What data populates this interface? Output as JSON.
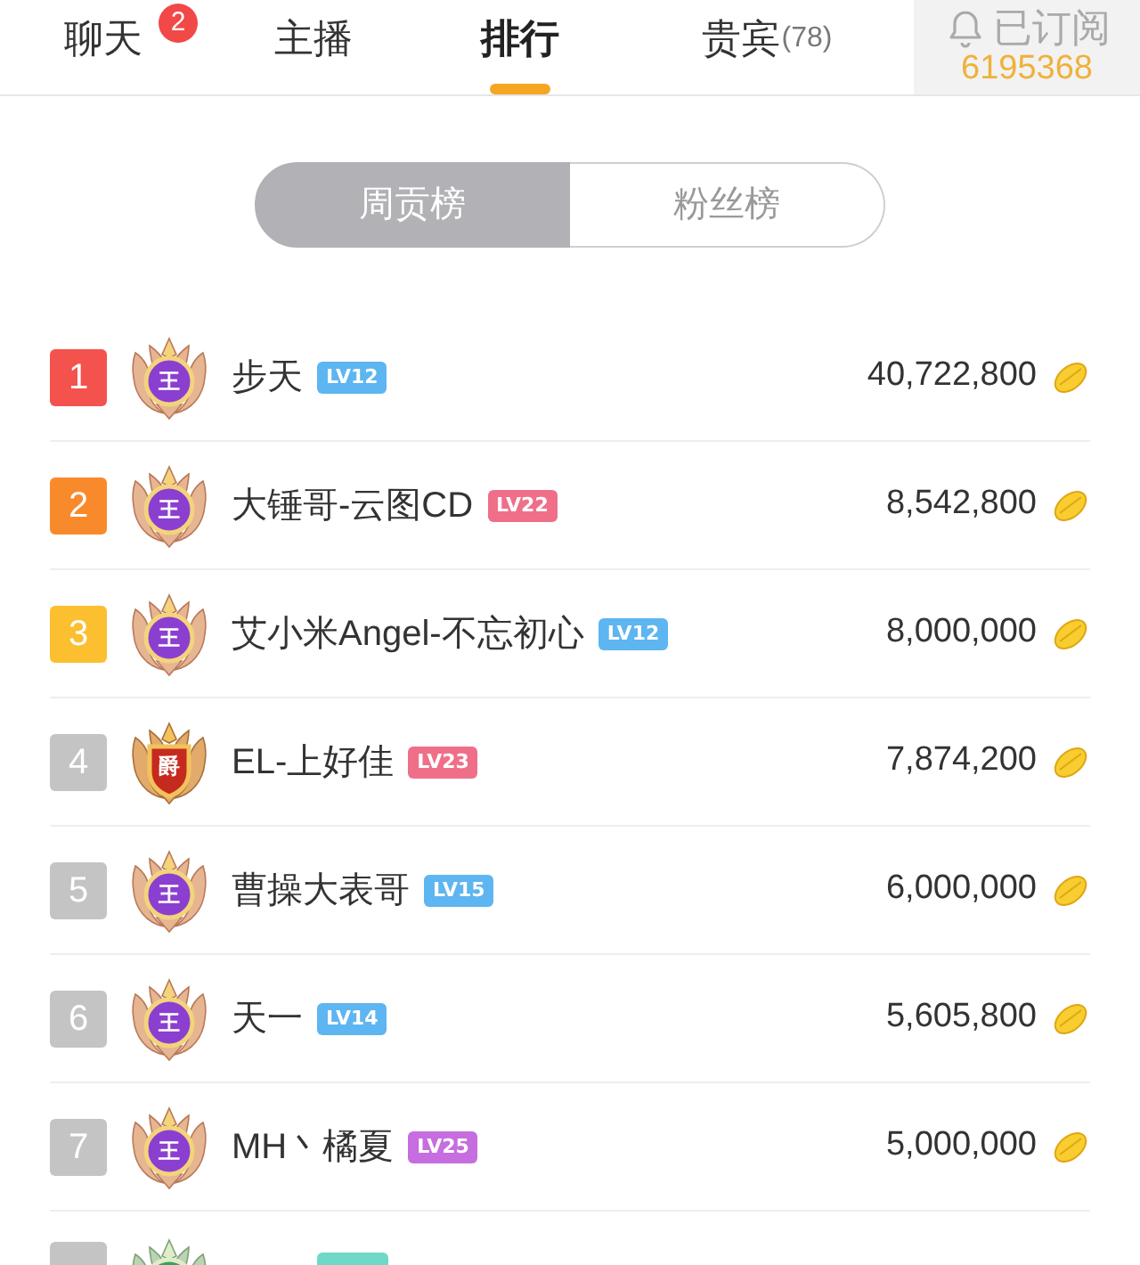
{
  "tabs": [
    {
      "label": "聊天",
      "badge": "2",
      "selected": false
    },
    {
      "label": "主播",
      "selected": false
    },
    {
      "label": "排行",
      "selected": true
    },
    {
      "label": "贵宾",
      "count": "(78)",
      "selected": false
    }
  ],
  "subscription": {
    "label": "已订阅",
    "count": "6195368"
  },
  "segments": [
    {
      "label": "周贡榜",
      "selected": true
    },
    {
      "label": "粉丝榜",
      "selected": false
    }
  ],
  "ranking": [
    {
      "kind": "full",
      "rank": {
        "text": "1",
        "color": "#f4524d"
      },
      "emblem": {
        "kind": "king",
        "character": "王"
      },
      "name": "步天",
      "lv_badge": {
        "text": "LV12",
        "color": "#5db5f1"
      },
      "amount": "40,722,800"
    },
    {
      "kind": "full",
      "rank": {
        "text": "2",
        "color": "#f98a2c"
      },
      "emblem": {
        "kind": "king",
        "character": "王"
      },
      "name": "大锤哥-云图CD",
      "lv_badge": {
        "text": "LV22",
        "color": "#ef6f89"
      },
      "amount": "8,542,800"
    },
    {
      "kind": "full",
      "rank": {
        "text": "3",
        "color": "#fbbf30"
      },
      "emblem": {
        "kind": "king",
        "character": "王"
      },
      "name": "艾小米Angel-不忘初心",
      "lv_badge": {
        "text": "LV12",
        "color": "#5db5f1"
      },
      "amount": "8,000,000"
    },
    {
      "kind": "full",
      "rank": {
        "text": "4",
        "color": "#c4c4c4"
      },
      "emblem": {
        "kind": "noble",
        "character": "爵"
      },
      "name": "EL-上好佳",
      "lv_badge": {
        "text": "LV23",
        "color": "#ef6f89"
      },
      "amount": "7,874,200"
    },
    {
      "kind": "full",
      "rank": {
        "text": "5",
        "color": "#c4c4c4"
      },
      "emblem": {
        "kind": "king",
        "character": "王"
      },
      "name": "曹操大表哥",
      "lv_badge": {
        "text": "LV15",
        "color": "#5db5f1"
      },
      "amount": "6,000,000"
    },
    {
      "kind": "full",
      "rank": {
        "text": "6",
        "color": "#c4c4c4"
      },
      "emblem": {
        "kind": "king",
        "character": "王"
      },
      "name": "天一",
      "lv_badge": {
        "text": "LV14",
        "color": "#5db5f1"
      },
      "amount": "5,605,800"
    },
    {
      "kind": "full",
      "rank": {
        "text": "7",
        "color": "#c4c4c4"
      },
      "emblem": {
        "kind": "king",
        "character": "王"
      },
      "name": "MH丶橘夏",
      "lv_badge": {
        "text": "LV25",
        "color": "#c66ddf"
      },
      "amount": "5,000,000"
    },
    {
      "kind": "cut",
      "rank": {
        "color": "#c4c4c4"
      },
      "emblem": {
        "kind": "knight"
      },
      "lv_badge": {
        "color": "#6fd9c8"
      }
    }
  ]
}
